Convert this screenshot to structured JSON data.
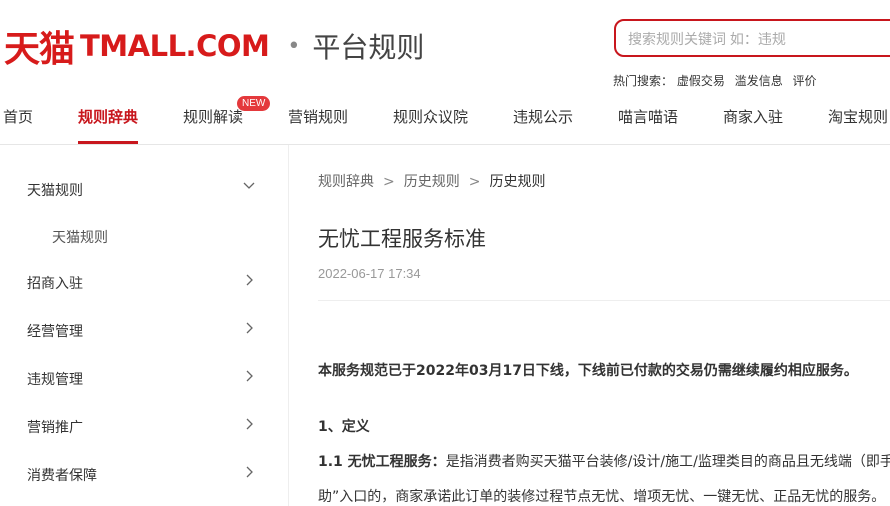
{
  "header": {
    "logo_cn": "天猫",
    "logo_en": "TMALL.COM",
    "dot": "•",
    "subtitle": "平台规则",
    "search_placeholder": "搜索规则关键词 如：违规",
    "hot_label": "热门搜索：",
    "hot_links": [
      "虚假交易",
      "滥发信息",
      "评价"
    ]
  },
  "nav": {
    "items": [
      "首页",
      "规则辞典",
      "规则解读",
      "营销规则",
      "规则众议院",
      "违规公示",
      "喵言喵语",
      "商家入驻",
      "淘宝规则"
    ],
    "badge": "NEW"
  },
  "sidebar": {
    "items": [
      "天猫规则",
      "招商入驻",
      "经营管理",
      "违规管理",
      "营销推广",
      "消费者保障"
    ],
    "sub_item": "天猫规则"
  },
  "breadcrumb": {
    "items": [
      "规则辞典",
      "历史规则",
      "历史规则"
    ],
    "separator": ">"
  },
  "article": {
    "title": "无忧工程服务标准",
    "date": "2022-06-17 17:34",
    "notice": "本服务规范已于2022年03月17日下线，下线前已付款的交易仍需继续履约相应服务。",
    "section1": "1、定义",
    "def_label": "1.1 无忧工程服务：",
    "def_text": "是指消费者购买天猫平台装修/设计/施工/监理类目的商品且无线端（即手",
    "def_cont": "助”入口的，商家承诺此订单的装修过程节点无忧、增项无忧、一键无忧、正品无忧的服务。"
  }
}
